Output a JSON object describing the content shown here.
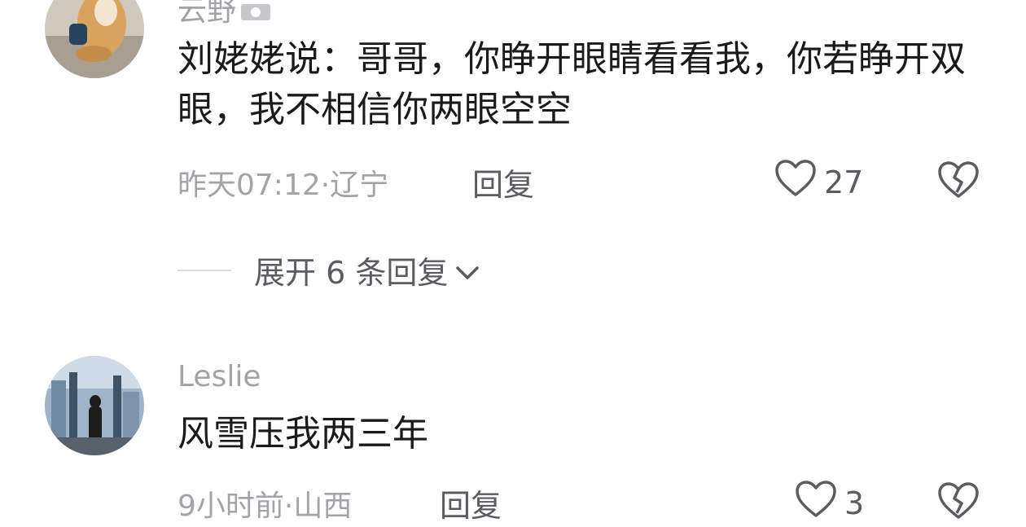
{
  "comments": [
    {
      "username": "云野",
      "text": "刘姥姥说：哥哥，你睁开眼睛看看我，你若睁开双眼，我不相信你两眼空空",
      "meta": "昨天07:12·辽宁",
      "reply_label": "回复",
      "likes": "27",
      "expand_label": "展开 6 条回复"
    },
    {
      "username": "Leslie",
      "text": "风雪压我两三年",
      "meta": "9小时前·山西",
      "reply_label": "回复",
      "likes": "3"
    }
  ],
  "icons": {
    "like": "heart-outline-icon",
    "dislike": "broken-heart-icon",
    "expand": "chevron-down-icon",
    "camera": "camera-icon"
  },
  "colors": {
    "text": "#1a1a1a",
    "meta": "#a3a3a8",
    "action": "#5b5b60"
  }
}
